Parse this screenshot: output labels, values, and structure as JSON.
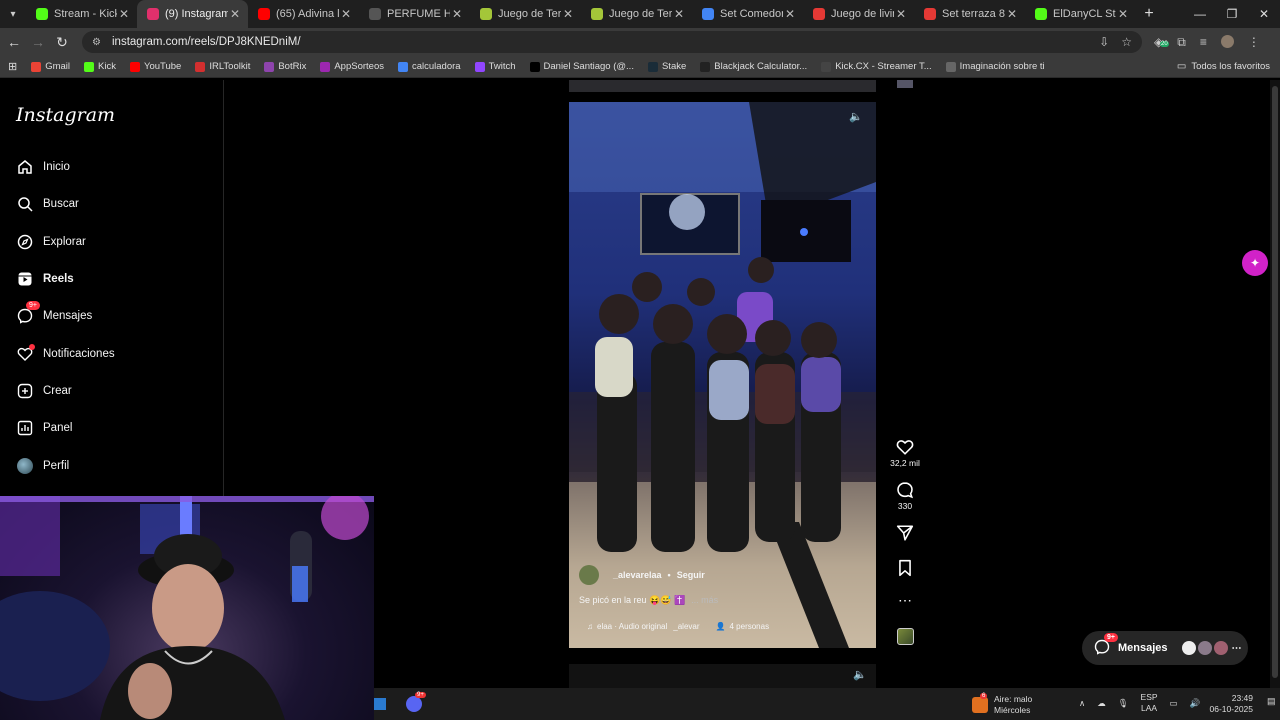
{
  "browser": {
    "tabs": [
      {
        "label": "Stream - Kick Da",
        "color": "#53fc18",
        "active": false
      },
      {
        "label": "(9) Instagram",
        "color": "#e1306c",
        "active": true
      },
      {
        "label": "(65) Adivina la Ca",
        "color": "#ff0000",
        "active": false
      },
      {
        "label": "PERFUME HOMB",
        "color": "#555555",
        "active": false
      },
      {
        "label": "Juego de Terraza",
        "color": "#a4c639",
        "active": false
      },
      {
        "label": "Juego de Terraza",
        "color": "#a4c639",
        "active": false
      },
      {
        "label": "Set Comedor Oce",
        "color": "#4285f4",
        "active": false
      },
      {
        "label": "Juego de living co",
        "color": "#e53935",
        "active": false
      },
      {
        "label": "Set terraza 8 pers",
        "color": "#e53935",
        "active": false
      },
      {
        "label": "ElDanyCL Stream",
        "color": "#53fc18",
        "active": false
      }
    ],
    "url": "instagram.com/reels/DPJ8KNEDniM/",
    "extension_badge": "20",
    "bookmarks": [
      {
        "label": "Gmail",
        "color": "#ea4335"
      },
      {
        "label": "Kick",
        "color": "#53fc18"
      },
      {
        "label": "YouTube",
        "color": "#ff0000"
      },
      {
        "label": "IRLToolkit",
        "color": "#d32f2f"
      },
      {
        "label": "BotRix",
        "color": "#8e44ad"
      },
      {
        "label": "AppSorteos",
        "color": "#9c27b0"
      },
      {
        "label": "calculadora",
        "color": "#4285f4"
      },
      {
        "label": "Twitch",
        "color": "#9146ff"
      },
      {
        "label": "Daniel Santiago (@...",
        "color": "#000000"
      },
      {
        "label": "Stake",
        "color": "#1a2c38"
      },
      {
        "label": "Blackjack Calculator...",
        "color": "#222222"
      },
      {
        "label": "Kick.CX - Streamer T...",
        "color": "#444444"
      },
      {
        "label": "Imaginación sobre ti",
        "color": "#666666"
      }
    ],
    "all_bookmarks": "Todos los favoritos"
  },
  "instagram": {
    "logo": "Instagram",
    "nav": [
      {
        "key": "home",
        "label": "Inicio",
        "icon": "home-icon"
      },
      {
        "key": "search",
        "label": "Buscar",
        "icon": "search-icon"
      },
      {
        "key": "explore",
        "label": "Explorar",
        "icon": "compass-icon"
      },
      {
        "key": "reels",
        "label": "Reels",
        "icon": "reels-icon"
      },
      {
        "key": "messages",
        "label": "Mensajes",
        "icon": "messenger-icon",
        "badge": "9+"
      },
      {
        "key": "notifications",
        "label": "Notificaciones",
        "icon": "heart-icon"
      },
      {
        "key": "create",
        "label": "Crear",
        "icon": "plus-square-icon"
      },
      {
        "key": "dashboard",
        "label": "Panel",
        "icon": "dashboard-icon"
      },
      {
        "key": "profile",
        "label": "Perfil",
        "icon": "avatar"
      }
    ],
    "reel": {
      "username": "_alevarelaa",
      "follow": "Seguir",
      "caption": "Se picó en la reu 😝😅 ✝️",
      "more": "... más",
      "audio": "elaa · Audio original",
      "audio_user": "_alevar",
      "people": "4 personas"
    },
    "actions": {
      "likes": "32,2 mil",
      "comments": "330"
    },
    "messages_button": {
      "label": "Mensajes",
      "badge": "9+"
    }
  },
  "taskbar": {
    "weather_badge": "6",
    "weather_line1": "Aire: malo",
    "weather_line2": "Miércoles",
    "discord_badge": "9+",
    "lang1": "ESP",
    "lang2": "LAA",
    "time": "23:49",
    "date": "06-10-2025"
  }
}
